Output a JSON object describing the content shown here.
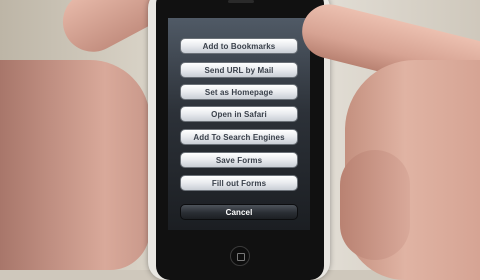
{
  "action_sheet": {
    "buttons": [
      {
        "label": "Add to Bookmarks"
      },
      {
        "label": "Send URL by Mail"
      },
      {
        "label": "Set as Homepage"
      },
      {
        "label": "Open in Safari"
      },
      {
        "label": "Add To Search Engines"
      },
      {
        "label": "Save Forms"
      },
      {
        "label": "Fill out Forms"
      }
    ],
    "cancel_label": "Cancel"
  },
  "colors": {
    "button_text": "#3a414b",
    "cancel_bg": "#2a2e34",
    "screen_bg": "#2c3138",
    "skin": "#d9a99a"
  }
}
